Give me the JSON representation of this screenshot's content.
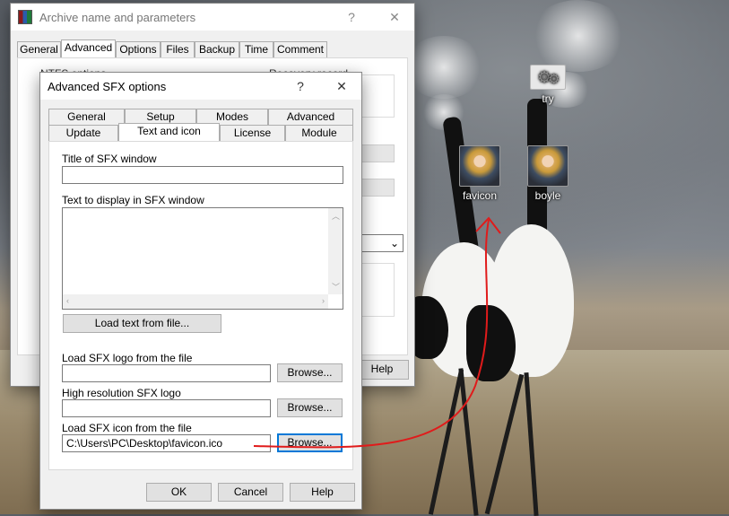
{
  "desktop": {
    "icons": [
      {
        "label": "try",
        "icon": "gears-icon"
      },
      {
        "label": "favicon",
        "icon": "portrait-icon"
      },
      {
        "label": "boyle",
        "icon": "portrait-icon"
      }
    ],
    "annotation_color": "#e01b1b"
  },
  "archive_dialog": {
    "title": "Archive name and parameters",
    "help_glyph": "?",
    "close_glyph": "✕",
    "tabs": [
      "General",
      "Advanced",
      "Options",
      "Files",
      "Backup",
      "Time",
      "Comment"
    ],
    "active_tab": "Advanced",
    "partial_labels": [
      "NTFS options",
      "Recovery record"
    ],
    "help_button": "Help"
  },
  "sfx_dialog": {
    "title": "Advanced SFX options",
    "help_glyph": "?",
    "close_glyph": "✕",
    "tabs_row1": [
      "General",
      "Setup",
      "Modes",
      "Advanced"
    ],
    "tabs_row2": [
      "Update",
      "Text and icon",
      "License",
      "Module"
    ],
    "active_tab": "Text and icon",
    "title_label": "Title of SFX window",
    "title_value": "",
    "text_label": "Text to display in SFX window",
    "text_value": "",
    "load_text_button": "Load text from file...",
    "logo_label": "Load SFX logo from the file",
    "logo_value": "",
    "hires_label": "High resolution SFX logo",
    "hires_value": "",
    "icon_label": "Load SFX icon from the file",
    "icon_value": "C:\\Users\\PC\\Desktop\\favicon.ico",
    "browse_label": "Browse...",
    "ok_button": "OK",
    "cancel_button": "Cancel",
    "help_button": "Help"
  }
}
